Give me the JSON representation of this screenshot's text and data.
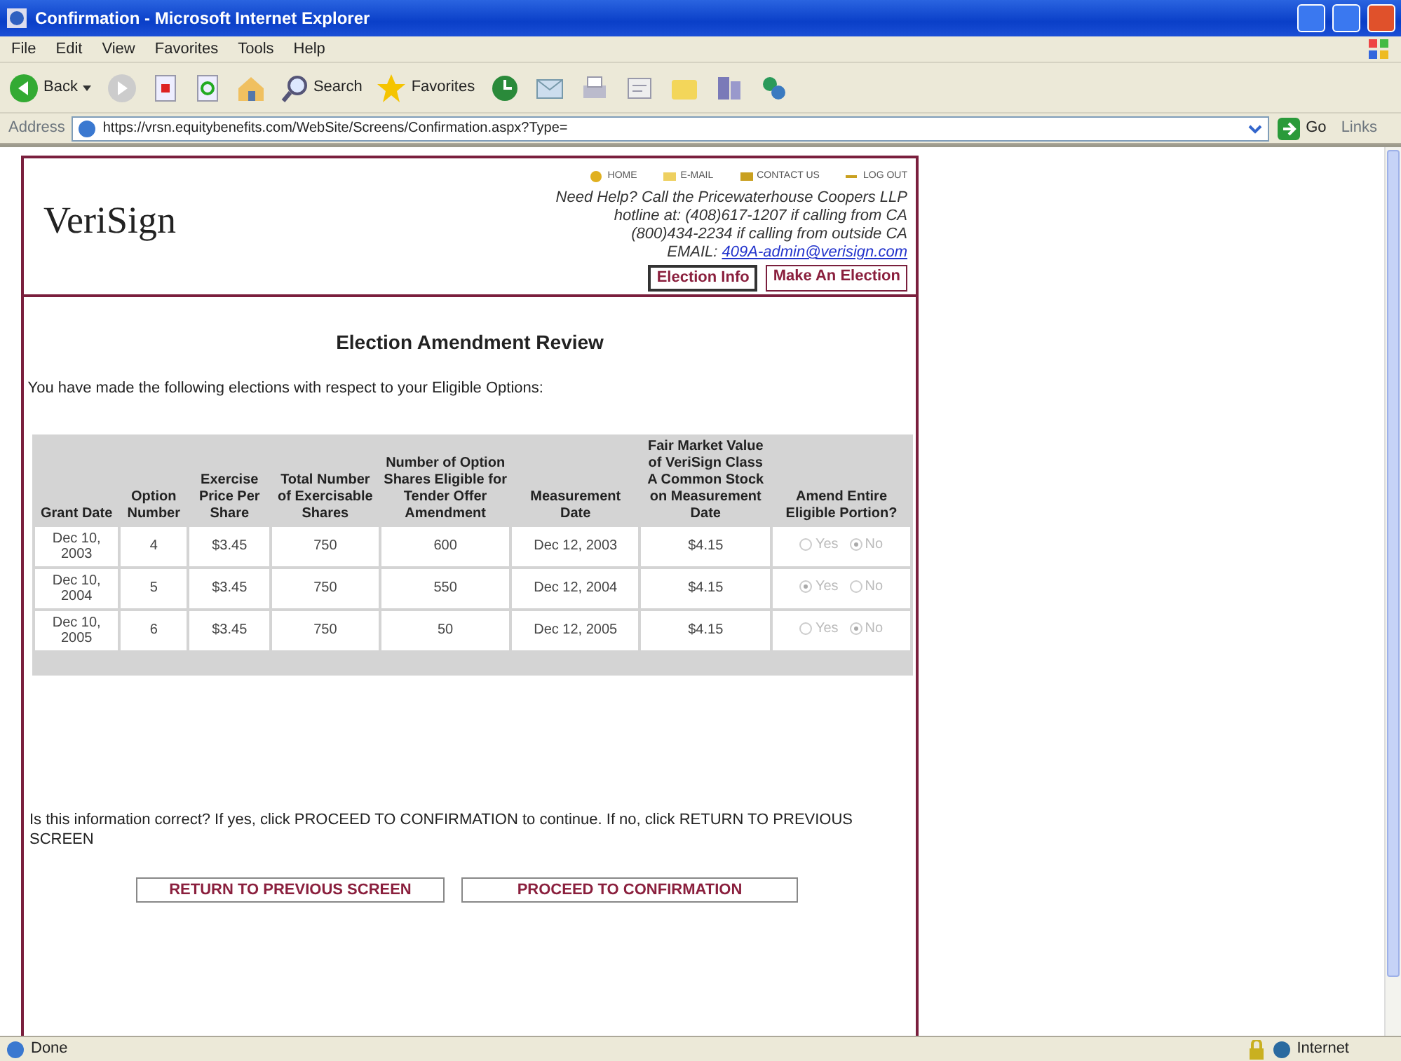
{
  "window": {
    "title": "Confirmation - Microsoft Internet Explorer"
  },
  "menu": [
    "File",
    "Edit",
    "View",
    "Favorites",
    "Tools",
    "Help"
  ],
  "toolbar": {
    "back": "Back",
    "search": "Search",
    "favorites": "Favorites"
  },
  "address_bar": {
    "label": "Address",
    "url": "https://vrsn.equitybenefits.com/WebSite/Screens/Confirmation.aspx?Type=",
    "go": "Go",
    "links": "Links"
  },
  "page": {
    "logo": "VeriSign",
    "top_links": [
      "HOME",
      "E-MAIL",
      "CONTACT US",
      "LOG OUT"
    ],
    "help_lines": [
      "Need Help? Call the Pricewaterhouse Coopers LLP",
      "hotline at: (408)617-1207 if calling from CA",
      "(800)434-2234 if calling from outside CA"
    ],
    "email_label": "EMAIL:",
    "email": "409A-admin@verisign.com",
    "nav_buttons": [
      {
        "label": "Election Info",
        "selected": true
      },
      {
        "label": "Make An Election",
        "selected": false
      }
    ],
    "heading": "Election Amendment Review",
    "intro": "You have made the following elections with respect to your Eligible Options:",
    "table": {
      "columns": [
        "Grant Date",
        "Option Number",
        "Exercise Price Per Share",
        "Total Number of Exercisable Shares",
        "Number of Option Shares Eligible for Tender Offer Amendment",
        "Measurement Date",
        "Fair Market Value of VeriSign Class A Common Stock on Measurement Date",
        "Amend Entire Eligible Portion?"
      ],
      "rows": [
        {
          "cells": [
            "Dec 10, 2003",
            "4",
            "$3.45",
            "750",
            "600",
            "Dec 12, 2003",
            "$4.15"
          ],
          "options": [
            {
              "label": "Yes",
              "selected": false
            },
            {
              "label": "No",
              "selected": true
            }
          ]
        },
        {
          "cells": [
            "Dec 10, 2004",
            "5",
            "$3.45",
            "750",
            "550",
            "Dec 12, 2004",
            "$4.15"
          ],
          "options": [
            {
              "label": "Yes",
              "selected": true
            },
            {
              "label": "No",
              "selected": false
            }
          ]
        },
        {
          "cells": [
            "Dec 10, 2005",
            "6",
            "$3.45",
            "750",
            "50",
            "Dec 12, 2005",
            "$4.15"
          ],
          "options": [
            {
              "label": "Yes",
              "selected": false
            },
            {
              "label": "No",
              "selected": true
            }
          ]
        }
      ]
    },
    "question": "Is this information correct? If yes, click PROCEED TO CONFIRMATION to continue. If no, click RETURN TO PREVIOUS SCREEN",
    "buttons": [
      "RETURN TO PREVIOUS SCREEN",
      "PROCEED TO CONFIRMATION"
    ]
  },
  "status_bar": {
    "left": "Done",
    "zone": "Internet"
  }
}
